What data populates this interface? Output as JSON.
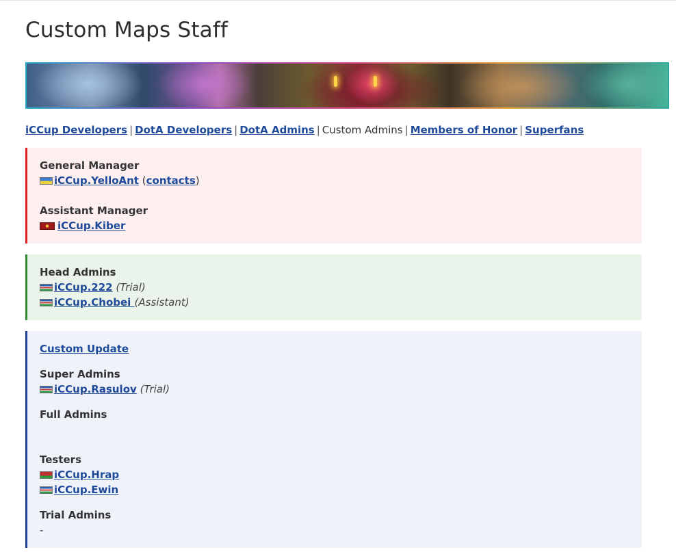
{
  "page": {
    "title": "Custom Maps Staff"
  },
  "nav": {
    "items": [
      {
        "label": "iCCup Developers"
      },
      {
        "label": "DotA Developers"
      },
      {
        "label": "DotA Admins"
      },
      {
        "label": "Custom Admins"
      },
      {
        "label": "Members of Honor"
      },
      {
        "label": "Superfans"
      }
    ],
    "separator": "|"
  },
  "management": {
    "general_manager": {
      "heading": "General Manager",
      "name": "iCCup.YelloAnt",
      "contacts_open": "(",
      "contacts_label": "contacts",
      "contacts_close": ")"
    },
    "assistant_manager": {
      "heading": "Assistant Manager",
      "name": "iCCup.Kiber"
    }
  },
  "head_admins": {
    "heading": "Head Admins",
    "members": [
      {
        "name": "iCCup.222",
        "note": "(Trial)"
      },
      {
        "name": "iCCup.Chobei ",
        "note": "(Assistant)"
      }
    ]
  },
  "custom": {
    "update_link": "Custom Update",
    "super_admins": {
      "heading": "Super Admins",
      "members": [
        {
          "name": "iCCup.Rasulov",
          "note": "(Trial)"
        }
      ]
    },
    "full_admins": {
      "heading": "Full Admins"
    },
    "testers": {
      "heading": "Testers",
      "members": [
        {
          "name": "iCCup.Hrap"
        },
        {
          "name": "iCCup.Ewin"
        }
      ]
    },
    "trial_admins": {
      "heading": "Trial Admins",
      "value": "-"
    }
  },
  "colors": {
    "link": "#1f4a9a",
    "red_accent": "#e02020",
    "green_accent": "#2e8a2e",
    "blue_accent": "#1f3f9f"
  }
}
